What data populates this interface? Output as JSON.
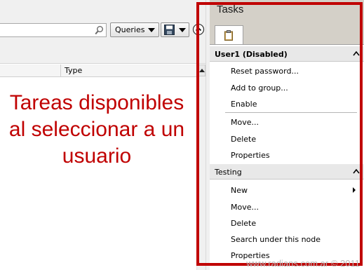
{
  "toolbar": {
    "queries_label": "Queries",
    "search_icon": "search-icon",
    "save_icon": "save-icon",
    "help_icon": "collapse-up-icon"
  },
  "list": {
    "columns": [
      "",
      "Type"
    ]
  },
  "annotation": {
    "lines": [
      "Tareas disponibles",
      "al seleccionar a un",
      "usuario"
    ],
    "color": "#c00000"
  },
  "tasks": {
    "title": "Tasks",
    "tab_icon": "clipboard-icon",
    "sections": [
      {
        "title": "User1 (Disabled)",
        "items": [
          "Reset password...",
          "Add to group...",
          "Enable",
          "Move...",
          "Delete",
          "Properties"
        ]
      },
      {
        "title": "Testing",
        "items": [
          "New",
          "Move...",
          "Delete",
          "Search under this node",
          "Properties"
        ]
      }
    ]
  },
  "watermark": "www.radians.com.ar © 2011",
  "colors": {
    "highlight": "#c00000",
    "pane_background": "#d4d0c8"
  }
}
